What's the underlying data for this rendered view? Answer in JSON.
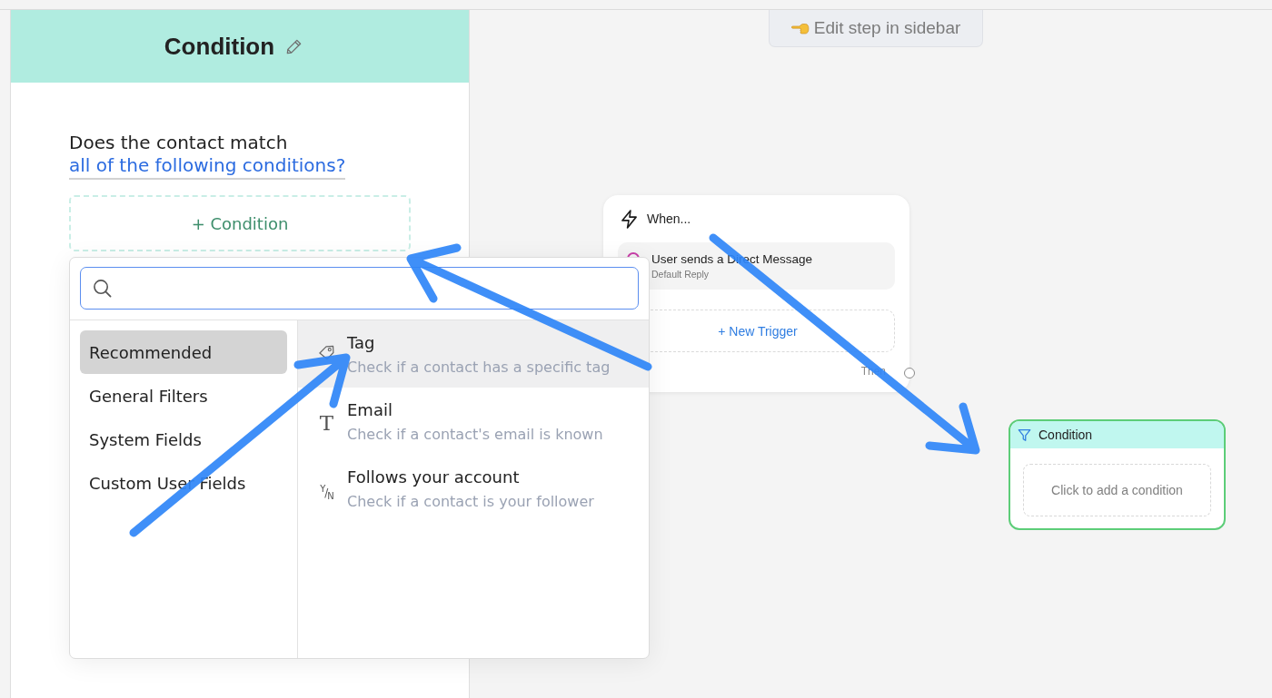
{
  "top_hint": {
    "label": "Edit step in sidebar"
  },
  "sidebar": {
    "title": "Condition",
    "question": "Does the contact match",
    "match_link": "all of the following conditions?",
    "add_button": "+ Condition"
  },
  "condition_picker": {
    "categories": [
      {
        "label": "Recommended",
        "selected": true
      },
      {
        "label": "General Filters",
        "selected": false
      },
      {
        "label": "System Fields",
        "selected": false
      },
      {
        "label": "Custom User Fields",
        "selected": false
      }
    ],
    "options": [
      {
        "kind": "tag",
        "title": "Tag",
        "description": "Check if a contact has a specific tag",
        "highlighted": true
      },
      {
        "kind": "text",
        "symbol": "T",
        "title": "Email",
        "description": "Check if a contact's email is known",
        "highlighted": false
      },
      {
        "kind": "boolean",
        "symbol": "$^{Y}$/$_{N}$",
        "title": "Follows your account",
        "description": "Check if a contact is your follower",
        "highlighted": false
      }
    ]
  },
  "canvas": {
    "trigger_node": {
      "title": "When...",
      "triggers": [
        {
          "title": "User sends a Direct Message",
          "subtitle": "Default Reply"
        }
      ],
      "add_button": "+ New Trigger",
      "output_label": "Then"
    },
    "condition_node": {
      "title": "Condition",
      "selected": true,
      "add_button": "Click to add a condition"
    }
  }
}
